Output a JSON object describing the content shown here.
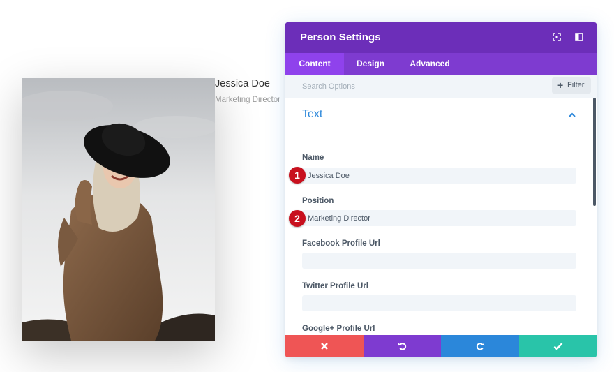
{
  "person": {
    "name": "Jessica Doe",
    "position": "Marketing Director"
  },
  "modal": {
    "title": "Person Settings",
    "header_icons": [
      "expand-icon",
      "sidebar-toggle-icon"
    ],
    "tabs": [
      {
        "label": "Content",
        "active": true
      },
      {
        "label": "Design",
        "active": false
      },
      {
        "label": "Advanced",
        "active": false
      }
    ],
    "search": {
      "placeholder": "Search Options",
      "value": ""
    },
    "filter_label": "Filter",
    "section": {
      "title": "Text",
      "expanded": true
    },
    "fields": [
      {
        "label": "Name",
        "value": "Jessica Doe",
        "marker": "1"
      },
      {
        "label": "Position",
        "value": "Marketing Director",
        "marker": "2"
      },
      {
        "label": "Facebook Profile Url",
        "value": ""
      },
      {
        "label": "Twitter Profile Url",
        "value": ""
      },
      {
        "label": "Google+ Profile Url",
        "value": ""
      }
    ],
    "footer_buttons": [
      {
        "name": "discard",
        "icon": "close-icon",
        "color": "#ef5555"
      },
      {
        "name": "undo",
        "icon": "undo-icon",
        "color": "#7e3bd0"
      },
      {
        "name": "redo",
        "icon": "redo-icon",
        "color": "#2b87da"
      },
      {
        "name": "save",
        "icon": "check-icon",
        "color": "#29c4a9"
      }
    ]
  },
  "colors": {
    "header": "#6c2eb9",
    "tabbar": "#7e3bd0",
    "active_tab": "#8f42ec",
    "section_title": "#2b87da",
    "marker": "#c8101e"
  }
}
